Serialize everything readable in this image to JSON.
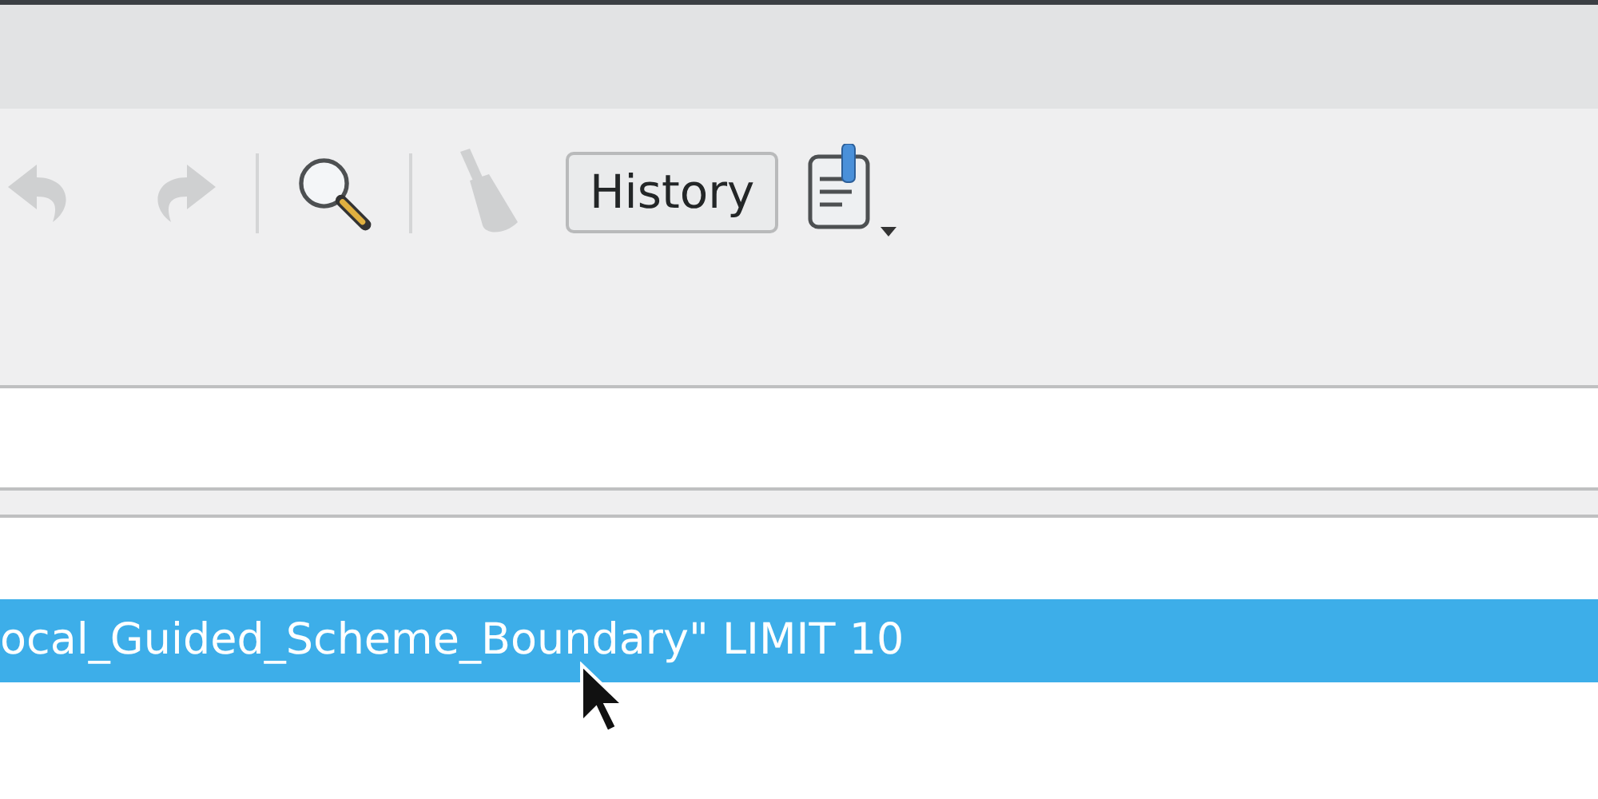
{
  "toolbar": [
    {
      "kind": "undo",
      "disabled": true
    },
    {
      "kind": "redo",
      "disabled": true
    },
    {
      "kind": "separator"
    },
    {
      "kind": "search",
      "disabled": false
    },
    {
      "kind": "separator"
    },
    {
      "kind": "clear",
      "disabled": true
    },
    {
      "kind": "button",
      "label": "History",
      "disabled": false
    },
    {
      "kind": "script",
      "disabled": false
    }
  ],
  "history": {
    "rows": [
      {
        "text": "ocal_Guided_Scheme_Boundary\" LIMIT 10",
        "selected": true
      }
    ]
  }
}
